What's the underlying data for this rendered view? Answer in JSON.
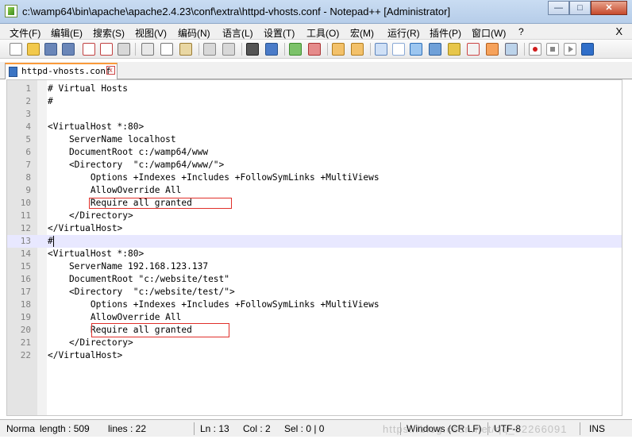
{
  "window": {
    "title": "c:\\wamp64\\bin\\apache\\apache2.4.23\\conf\\extra\\httpd-vhosts.conf - Notepad++ [Administrator]",
    "minimize": "—",
    "maximize": "□",
    "close": "✕"
  },
  "menu": {
    "items": [
      "文件(F)",
      "编辑(E)",
      "搜索(S)",
      "视图(V)",
      "编码(N)",
      "语言(L)",
      "设置(T)",
      "工具(O)",
      "宏(M)",
      "运行(R)",
      "插件(P)",
      "窗口(W)",
      "?"
    ],
    "close": "X"
  },
  "tab": {
    "label": "httpd-vhosts.conf",
    "close": "x"
  },
  "editor": {
    "current_line": 13,
    "lines": [
      "# Virtual Hosts",
      "#",
      "",
      "<VirtualHost *:80>",
      "    ServerName localhost",
      "    DocumentRoot c:/wamp64/www",
      "    <Directory  \"c:/wamp64/www/\">",
      "        Options +Indexes +Includes +FollowSymLinks +MultiViews",
      "        AllowOverride All",
      "        Require all granted",
      "    </Directory>",
      "</VirtualHost>",
      "#",
      "<VirtualHost *:80>",
      "    ServerName 192.168.123.137",
      "    DocumentRoot \"c:/website/test\"",
      "    <Directory  \"c:/website/test/\">",
      "        Options +Indexes +Includes +FollowSymLinks +MultiViews",
      "        AllowOverride All",
      "        Require all granted",
      "    </Directory>",
      "</VirtualHost>"
    ]
  },
  "status": {
    "type": "Norma",
    "length": "length : 509",
    "lines": "lines : 22",
    "ln": "Ln : 13",
    "col": "Col : 2",
    "sel": "Sel : 0 | 0",
    "eol": "Windows (CR LF)",
    "encoding": "UTF-8",
    "mode": "INS",
    "watermark": "https://blog.csdn.net/qq_32266091"
  },
  "colors": {
    "highlight_box": "#e0302a",
    "current_line": "#e8e8ff",
    "active_tab_accent": "#fa9a3a"
  }
}
